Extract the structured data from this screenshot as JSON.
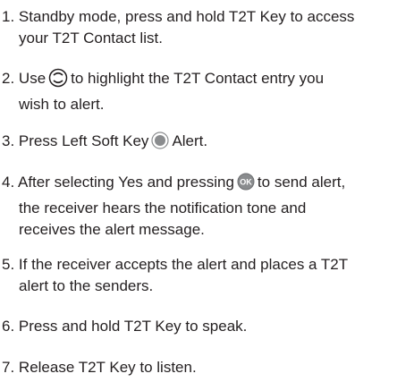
{
  "steps": [
    {
      "number": "1.",
      "line1": "Standby mode, press and hold T2T Key to access",
      "line2": "your T2T Contact list."
    },
    {
      "number": "2.",
      "line1_pre": "Use",
      "line1_post": "to highlight the T2T Contact entry you",
      "line2": "wish to alert.",
      "icon": "navigation-key-icon"
    },
    {
      "number": "3.",
      "line1_pre": "Press Left Soft Key",
      "line1_post": "Alert.",
      "icon": "left-soft-key-icon"
    },
    {
      "number": "4.",
      "line1_pre": "After selecting Yes and pressing",
      "line1_post": "to send alert,",
      "line2": "the receiver hears the notification tone and",
      "line3": "receives the alert message.",
      "icon": "ok-key-icon",
      "icon_label": "OK"
    },
    {
      "number": "5.",
      "line1": "If the receiver accepts the alert and places a T2T",
      "line2": "alert to the senders."
    },
    {
      "number": "6.",
      "line1": "Press and hold T2T Key to speak."
    },
    {
      "number": "7.",
      "line1": "Release T2T Key to listen."
    }
  ],
  "colors": {
    "text": "#231f20",
    "icon_fill": "#8a8c8e",
    "icon_stroke": "#231f20"
  }
}
